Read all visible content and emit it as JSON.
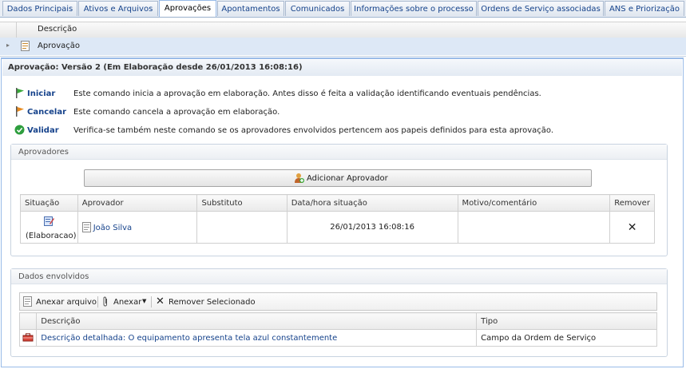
{
  "tabs": [
    {
      "label": "Dados Principais"
    },
    {
      "label": "Ativos e Arquivos"
    },
    {
      "label": "Aprovações"
    },
    {
      "label": "Apontamentos"
    },
    {
      "label": "Comunicados"
    },
    {
      "label": "Informações sobre o processo"
    },
    {
      "label": "Ordens de Serviço associadas"
    },
    {
      "label": "ANS e Priorização"
    }
  ],
  "top_grid": {
    "header": "Descrição",
    "row_label": "Aprovação"
  },
  "panel": {
    "title": "Aprovação: Versão 2 (Em Elaboração desde 26/01/2013 16:08:16)"
  },
  "commands": [
    {
      "label": "Iniciar",
      "desc": "Este comando inicia a aprovação em elaboração. Antes disso é feita a validação identificando eventuais pendências.",
      "icon": "green-flag-icon"
    },
    {
      "label": "Cancelar",
      "desc": "Este comando cancela a aprovação em elaboração.",
      "icon": "orange-flag-icon"
    },
    {
      "label": "Validar",
      "desc": "Verifica-se também neste comando se os aprovadores envolvidos pertencem aos papeis definidos para esta aprovação.",
      "icon": "check-circle-icon"
    }
  ],
  "aprovadores": {
    "legend": "Aprovadores",
    "add_button": "Adicionar Aprovador",
    "columns": [
      "Situação",
      "Aprovador",
      "Substituto",
      "Data/hora situação",
      "Motivo/comentário",
      "Remover"
    ],
    "rows": [
      {
        "situacao": "(Elaboracao)",
        "aprovador": "João Silva",
        "substituto": "",
        "data": "26/01/2013 16:08:16",
        "motivo": "",
        "remover": "✕"
      }
    ]
  },
  "dados": {
    "legend": "Dados envolvidos",
    "toolbar": {
      "anexar_arquivo": "Anexar arquivo",
      "anexar": "Anexar",
      "remover": "Remover Selecionado"
    },
    "columns": [
      "Descrição",
      "Tipo"
    ],
    "rows": [
      {
        "descricao": "Descrição detalhada: O equipamento apresenta tela azul constantemente",
        "tipo": "Campo da Ordem de Serviço"
      }
    ]
  }
}
